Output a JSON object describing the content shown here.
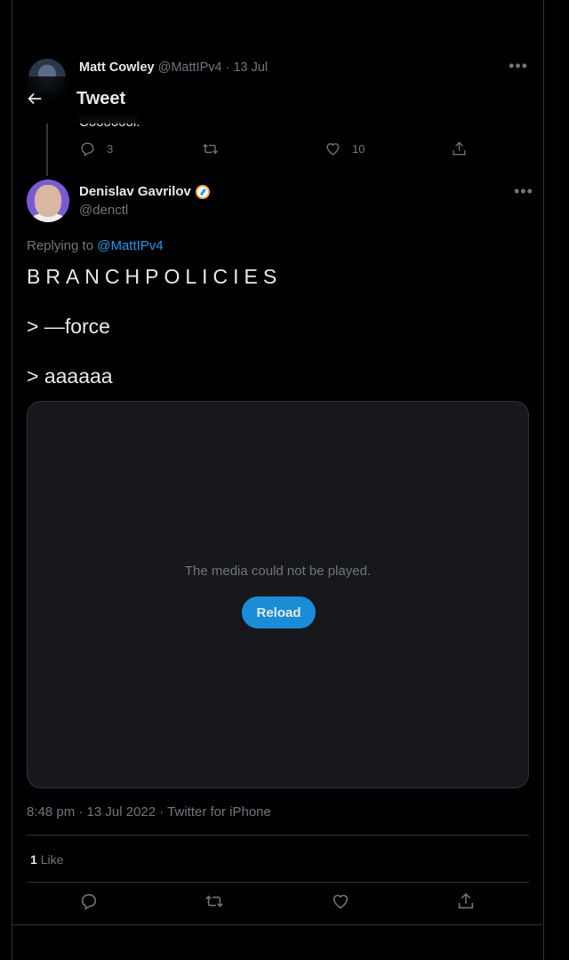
{
  "parent_tweet": {
    "name": "Matt Cowley",
    "handle": "@MattIPv4",
    "date": "· 13 Jul",
    "text": "Cooooool.",
    "reply_count": "3",
    "like_count": "10"
  },
  "header": {
    "title": "Tweet"
  },
  "main_tweet": {
    "name": "Denislav Gavrilov",
    "handle": "@denctl",
    "replying_prefix": "Replying to",
    "replying_to": "@MattIPv4",
    "line1": "BRANCHPOLICIES",
    "line2": "> —force",
    "line3": "> aaaaaa",
    "media_message": "The media could not be played.",
    "reload_label": "Reload",
    "timestamp": "8:48 pm · 13 Jul 2022 · Twitter for iPhone",
    "like_count": "1",
    "like_label": "Like"
  },
  "colors": {
    "accent": "#1d9bf0",
    "button": "#1a8cd8",
    "muted": "#71767b",
    "border": "#2f3336"
  }
}
